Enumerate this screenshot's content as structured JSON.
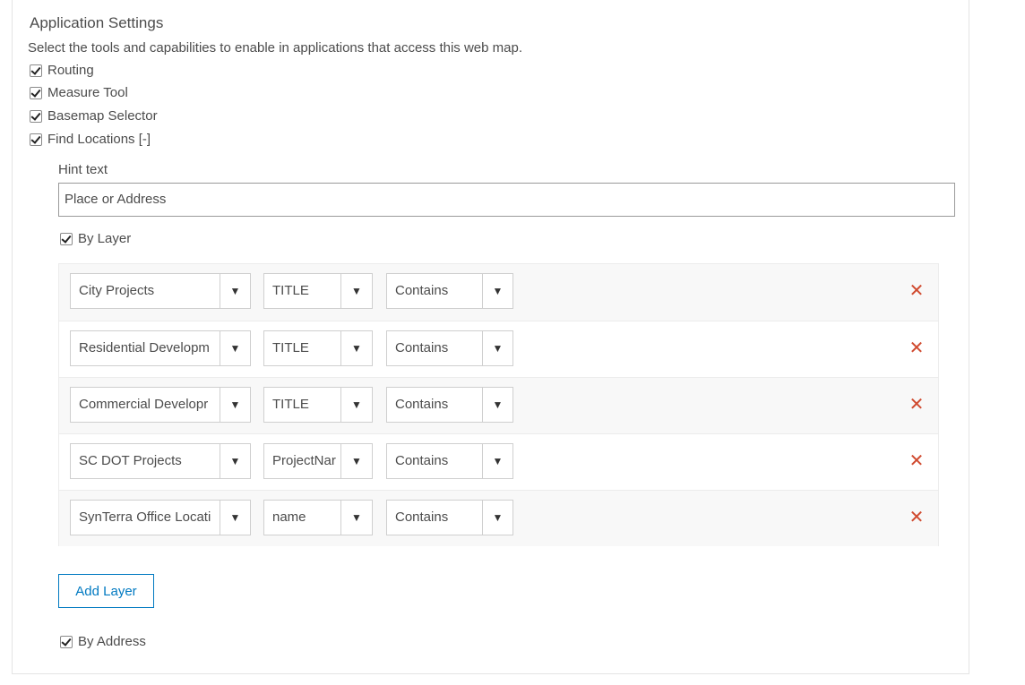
{
  "section": {
    "title": "Application Settings",
    "description": "Select the tools and capabilities to enable in applications that access this web map."
  },
  "options": [
    {
      "label": "Routing",
      "checked": true
    },
    {
      "label": "Measure Tool",
      "checked": true
    },
    {
      "label": "Basemap Selector",
      "checked": true
    },
    {
      "label": "Find Locations [-]",
      "checked": true
    }
  ],
  "find_locations": {
    "hint_label": "Hint text",
    "hint_value": "Place or Address",
    "by_layer_label": "By Layer",
    "by_layer_checked": true,
    "layers": [
      {
        "layer": "City Projects",
        "field": "TITLE",
        "operator": "Contains"
      },
      {
        "layer": "Residential Developm",
        "field": "TITLE",
        "operator": "Contains"
      },
      {
        "layer": "Commercial Developr",
        "field": "TITLE",
        "operator": "Contains"
      },
      {
        "layer": "SC DOT Projects",
        "field": "ProjectNar",
        "operator": "Contains"
      },
      {
        "layer": "SynTerra Office Locati",
        "field": "name",
        "operator": "Contains"
      }
    ],
    "add_layer_label": "Add Layer",
    "by_address_label": "By Address",
    "by_address_checked": true
  },
  "icons": {
    "dropdown": "chevron-down-icon",
    "remove": "close-icon",
    "check": "checkmark-icon"
  },
  "colors": {
    "accent": "#0079c1",
    "remove": "#d04a2f",
    "text": "#4c4c4c"
  }
}
